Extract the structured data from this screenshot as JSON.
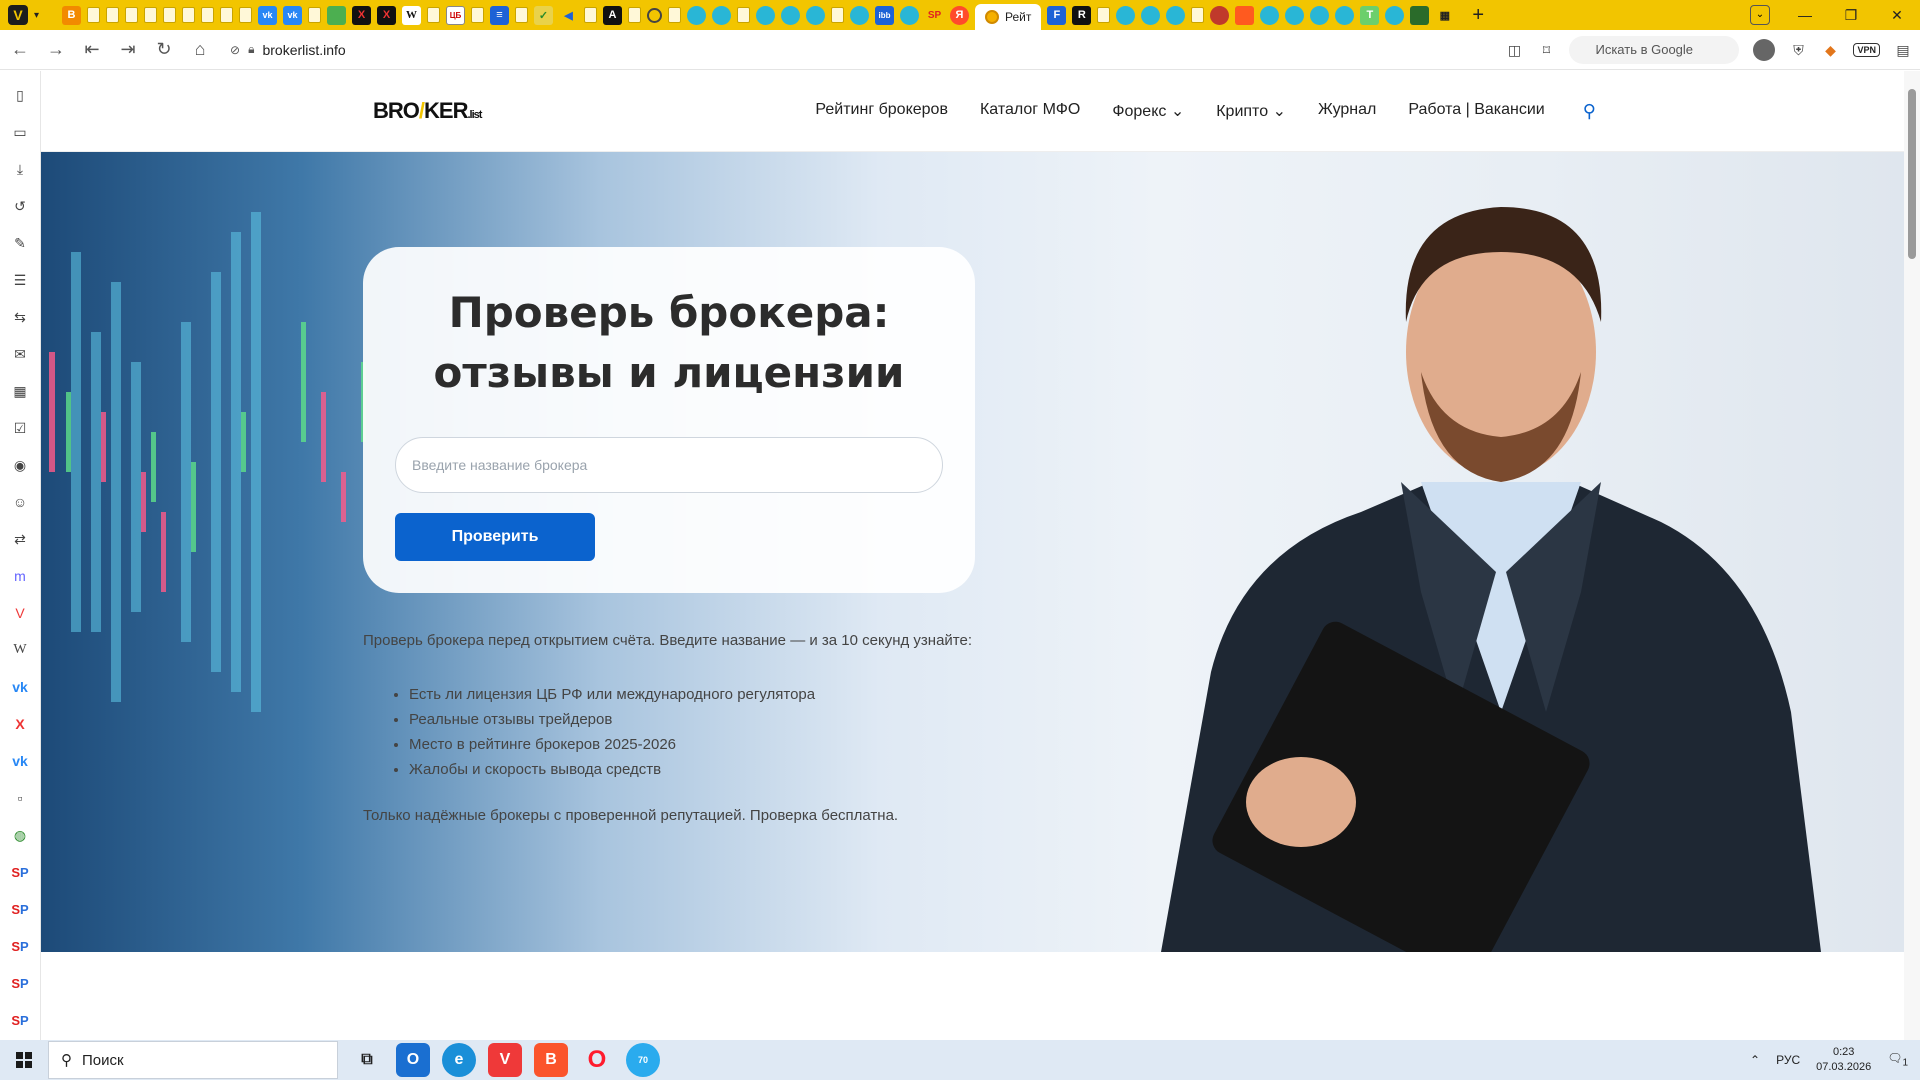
{
  "browser": {
    "active_tab_title": "Рейт",
    "url": "brokerlist.info",
    "search_placeholder": "Искать в Google",
    "vpn_label": "VPN"
  },
  "site": {
    "logo_main": "BRO",
    "logo_mid": "KER",
    "logo_suffix": ".list",
    "nav": [
      "Рейтинг брокеров",
      "Каталог МФО",
      "Форекс",
      "Крипто",
      "Журнал",
      "Работа | Вакансии"
    ],
    "nav_dropdown_indicator": "⌄"
  },
  "hero": {
    "title_line1": "Проверь брокера:",
    "title_line2": "отзывы и лицензии",
    "input_placeholder": "Введите название брокера",
    "button_label": "Проверить",
    "lead": "Проверь брокера перед открытием счёта. Введите название — и за 10 секунд узнайте:",
    "bullets": [
      "Есть ли лицензия ЦБ РФ или международного регулятора",
      "Реальные отзывы трейдеров",
      "Место в рейтинге брокеров 2025-2026",
      "Жалобы и скорость вывода средств"
    ],
    "footnote": "Только надёжные брокеры с проверенной репутацией. Проверка бесплатна."
  },
  "sidepanel": {
    "sp_label_a": "S",
    "sp_label_b": "P"
  },
  "taskbar": {
    "search_label": "Поиск",
    "lang": "РУС",
    "time": "0:23",
    "date": "07.03.2026",
    "telegram_badge": "70",
    "notif_count": "1"
  }
}
